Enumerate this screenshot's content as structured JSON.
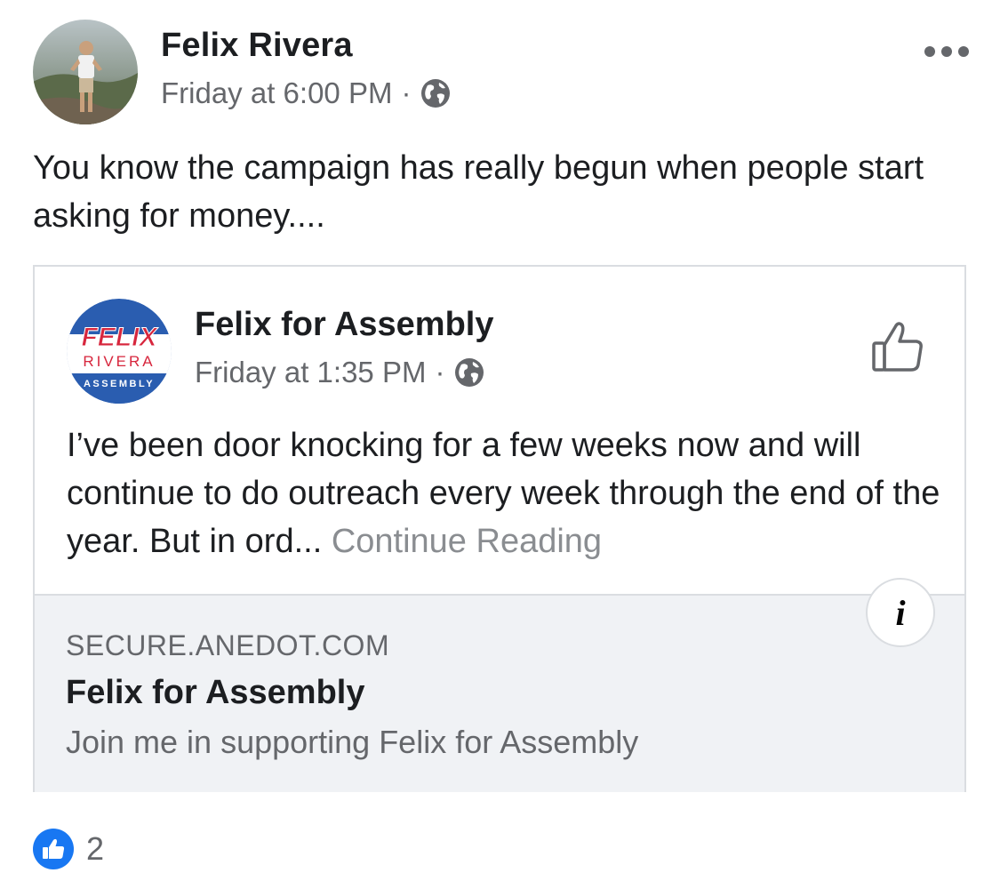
{
  "post": {
    "author_name": "Felix Rivera",
    "timestamp": "Friday at 6:00 PM",
    "separator": "·",
    "privacy_icon": "globe-icon",
    "more_icon": "more-horizontal-icon",
    "text": "You know the campaign has really begun when people start asking for money...."
  },
  "shared_post": {
    "page_name": "Felix for Assembly",
    "timestamp": "Friday at 1:35 PM",
    "separator": "·",
    "privacy_icon": "globe-icon",
    "like_page_icon": "thumbs-up-outline-icon",
    "logo_text": {
      "line1": "FELIX",
      "line2": "RIVERA",
      "line3": "ASSEMBLY"
    },
    "text": "I’ve been door knocking for a few weeks now and will continue to do outreach every week through the end of the year. But in ord...",
    "continue_label": "Continue Reading"
  },
  "link_preview": {
    "domain": "SECURE.ANEDOT.COM",
    "title": "Felix for Assembly",
    "description": "Join me in supporting Felix for Assembly",
    "info_icon": "info-icon",
    "info_label": "i"
  },
  "reactions": {
    "icon": "like-reaction-icon",
    "count": "2"
  },
  "colors": {
    "primary_text": "#1c1e21",
    "secondary_text": "#65676b",
    "like_blue": "#1877f2",
    "preview_bg": "#f0f2f5",
    "logo_red": "#d7263d",
    "logo_blue": "#2a5db0"
  }
}
